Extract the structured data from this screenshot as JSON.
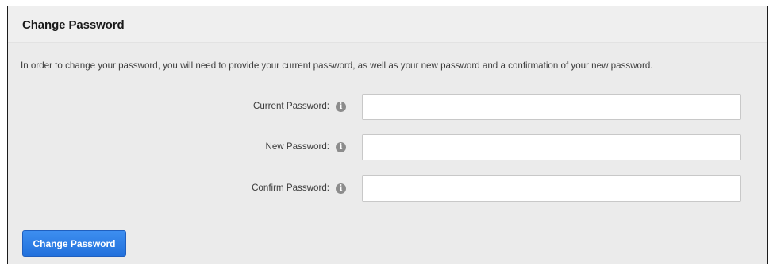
{
  "panel": {
    "title": "Change Password",
    "intro": "In order to change your password, you will need to provide your current password, as well as your new password and a confirmation of your new password."
  },
  "form": {
    "fields": [
      {
        "label": "Current Password:",
        "value": "",
        "icon": "info-icon"
      },
      {
        "label": "New Password:",
        "value": "",
        "icon": "info-icon"
      },
      {
        "label": "Confirm Password:",
        "value": "",
        "icon": "info-icon"
      }
    ],
    "info_glyph": "i"
  },
  "actions": {
    "submit_label": "Change Password",
    "submit_color": "#2a7ae4"
  }
}
